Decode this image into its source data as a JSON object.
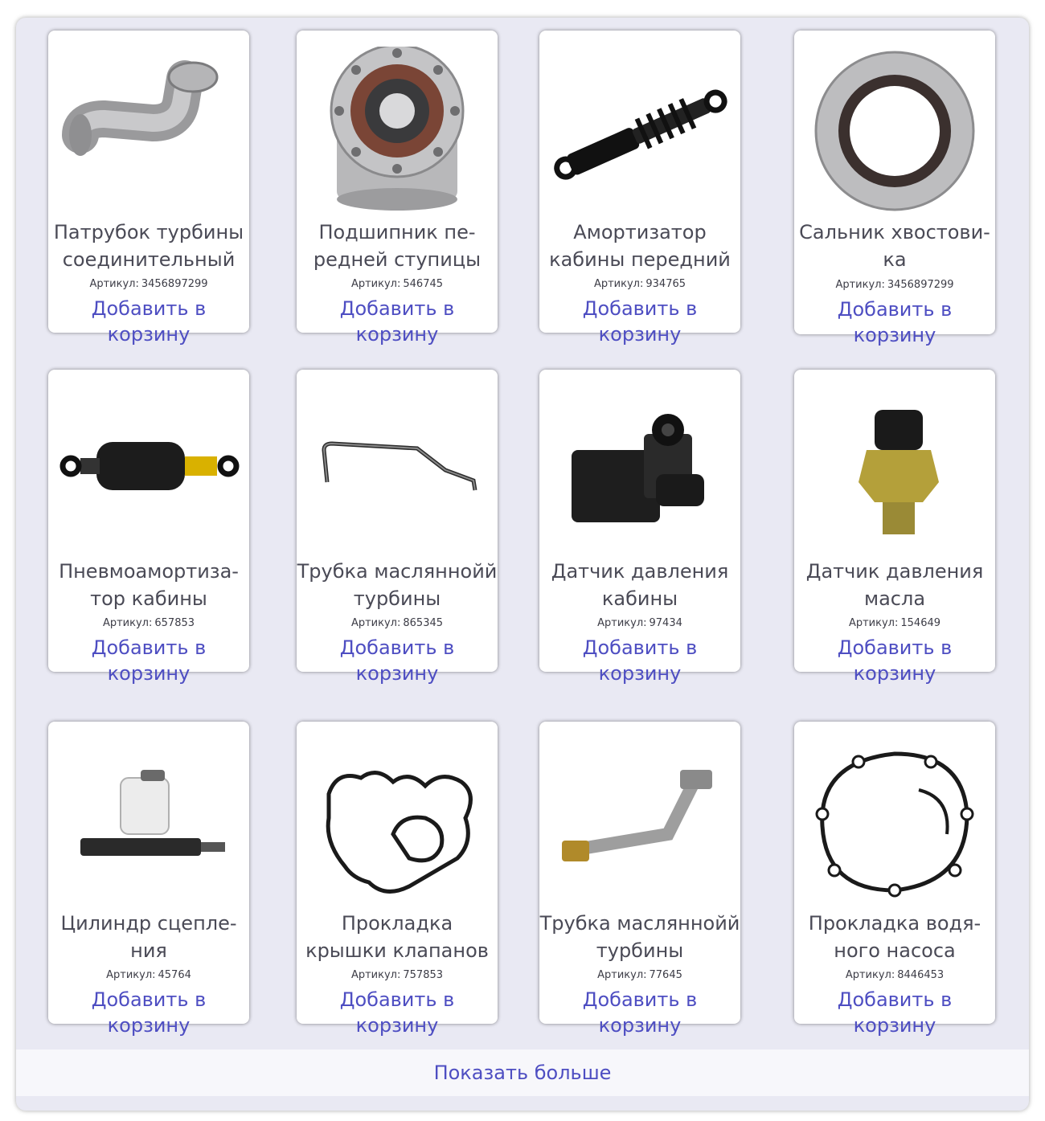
{
  "products": [
    {
      "name": "Патрубок турбины\nсоединительный",
      "sku_label": "Артикул:",
      "sku": "3456897299",
      "cart_label": "Добавить в корзину",
      "icon": "turbo-pipe-icon"
    },
    {
      "name": "Подшипник пе-\nредней ступицы",
      "sku_label": "Артикул:",
      "sku": "546745",
      "cart_label": "Добавить в корзину",
      "icon": "hub-bearing-icon"
    },
    {
      "name": "Амортизатор\nкабины передний",
      "sku_label": "Артикул:",
      "sku": "934765",
      "cart_label": "Добавить в корзину",
      "icon": "shock-absorber-icon"
    },
    {
      "name": "Сальник хвостови-\nка",
      "sku_label": "Артикул:",
      "sku": "3456897299",
      "cart_label": "Добавить в корзину",
      "icon": "oil-seal-icon"
    },
    {
      "name": "Пневмоамортиза-\nтор кабины",
      "sku_label": "Артикул:",
      "sku": "657853",
      "cart_label": "Добавить в корзину",
      "icon": "air-shock-icon"
    },
    {
      "name": "Трубка масляннойй\nтурбины",
      "sku_label": "Артикул:",
      "sku": "865345",
      "cart_label": "Добавить в корзину",
      "icon": "oil-tube-icon"
    },
    {
      "name": "Датчик давления\nкабины",
      "sku_label": "Артикул:",
      "sku": "97434",
      "cart_label": "Добавить в корзину",
      "icon": "pressure-sensor-icon"
    },
    {
      "name": "Датчик давления\nмасла",
      "sku_label": "Артикул:",
      "sku": "154649",
      "cart_label": "Добавить в корзину",
      "icon": "oil-pressure-sensor-icon"
    },
    {
      "name": "Цилиндр сцепле-\nния",
      "sku_label": "Артикул:",
      "sku": "45764",
      "cart_label": "Добавить в корзину",
      "icon": "clutch-cylinder-icon"
    },
    {
      "name": "Прокладка\nкрышки клапанов",
      "sku_label": "Артикул:",
      "sku": "757853",
      "cart_label": "Добавить в корзину",
      "icon": "valve-gasket-icon"
    },
    {
      "name": "Трубка масляннойй\nтурбины",
      "sku_label": "Артикул:",
      "sku": "77645",
      "cart_label": "Добавить в корзину",
      "icon": "oil-tube-icon"
    },
    {
      "name": "Прокладка водя-\nного насоса",
      "sku_label": "Артикул:",
      "sku": "8446453",
      "cart_label": "Добавить в корзину",
      "icon": "water-pump-gasket-icon"
    }
  ],
  "show_more_label": "Показать больше"
}
